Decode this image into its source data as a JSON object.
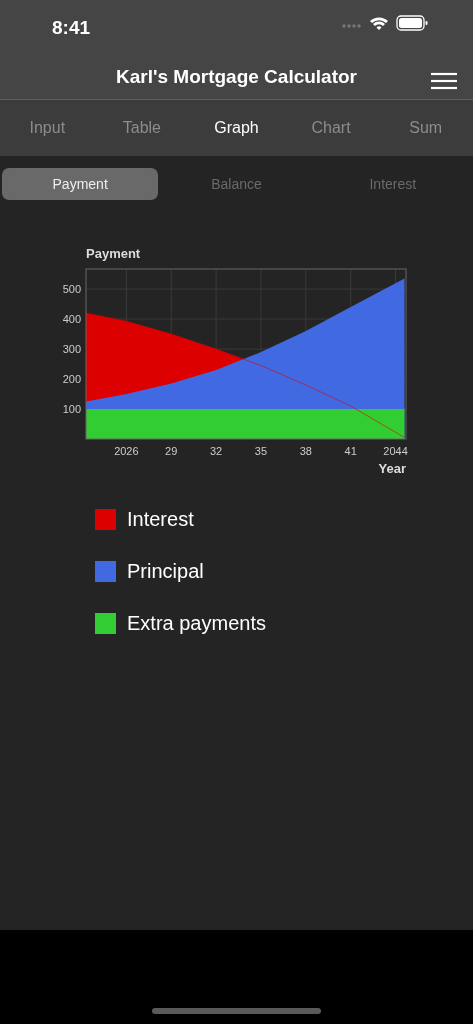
{
  "status_bar": {
    "time": "8:41"
  },
  "header": {
    "title": "Karl's Mortgage Calculator"
  },
  "tabs": [
    {
      "label": "Input",
      "selected": false
    },
    {
      "label": "Table",
      "selected": false
    },
    {
      "label": "Graph",
      "selected": true
    },
    {
      "label": "Chart",
      "selected": false
    },
    {
      "label": "Sum",
      "selected": false
    }
  ],
  "segments": [
    {
      "label": "Payment",
      "selected": true
    },
    {
      "label": "Balance",
      "selected": false
    },
    {
      "label": "Interest",
      "selected": false
    }
  ],
  "chart": {
    "chart_data": {
      "type": "area",
      "title": "Payment",
      "xlabel": "Year",
      "x": [
        2023.3,
        2026,
        2029,
        2032,
        2035,
        2038,
        2041,
        2044.6
      ],
      "series": [
        {
          "name": "Interest",
          "color": "#dd0000",
          "values": [
            420,
            393,
            350,
            300,
            245,
            180,
            110,
            5
          ]
        },
        {
          "name": "Principal",
          "color": "#4169e1",
          "values": [
            125,
            150,
            185,
            230,
            290,
            360,
            440,
            535
          ]
        },
        {
          "name": "Extra payments",
          "color": "#32cd32",
          "values": [
            100,
            100,
            100,
            100,
            100,
            100,
            100,
            100
          ]
        }
      ],
      "xlim": [
        2023.3,
        2044.7
      ],
      "ylim": [
        0,
        567
      ],
      "xticks": [
        {
          "value": 2026,
          "label": "2026"
        },
        {
          "value": 2029,
          "label": "29"
        },
        {
          "value": 2032,
          "label": "32"
        },
        {
          "value": 2035,
          "label": "35"
        },
        {
          "value": 2038,
          "label": "38"
        },
        {
          "value": 2041,
          "label": "41"
        },
        {
          "value": 2044,
          "label": "2044"
        }
      ],
      "yticks": [
        100,
        200,
        300,
        400,
        500
      ],
      "grid": true
    }
  }
}
